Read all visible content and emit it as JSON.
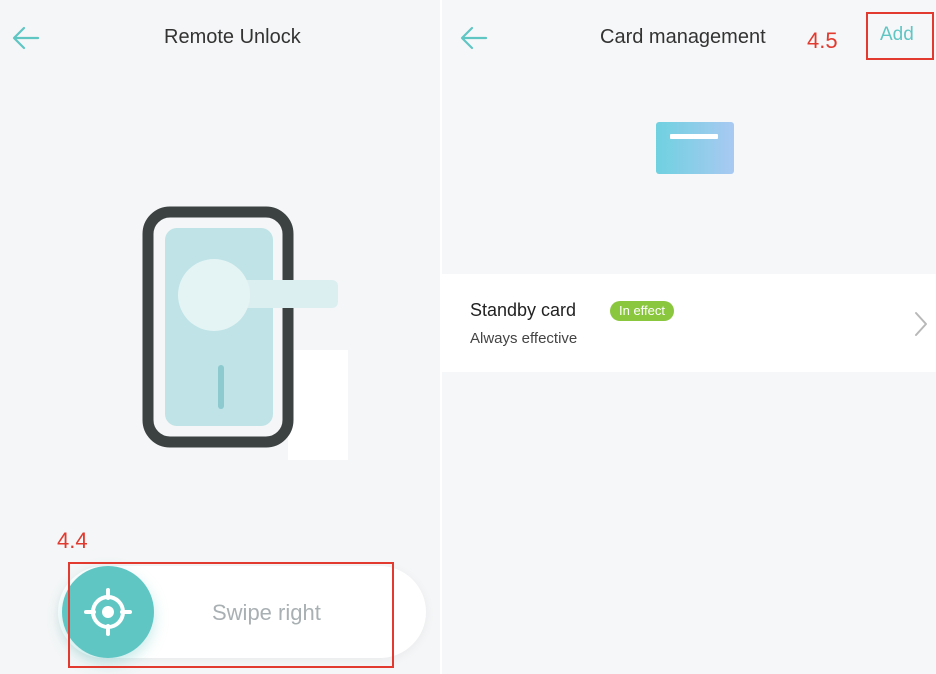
{
  "left_screen": {
    "title": "Remote Unlock",
    "annotation": "4.4",
    "swipe_label": "Swipe right"
  },
  "right_screen": {
    "title": "Card management",
    "annotation": "4.5",
    "add_label": "Add",
    "card": {
      "name": "Standby card",
      "status_badge": "In effect",
      "validity": "Always effective"
    }
  },
  "colors": {
    "accent": "#5fc6c4",
    "annotation_red": "#e23a2f",
    "badge_green": "#8bc63f"
  }
}
